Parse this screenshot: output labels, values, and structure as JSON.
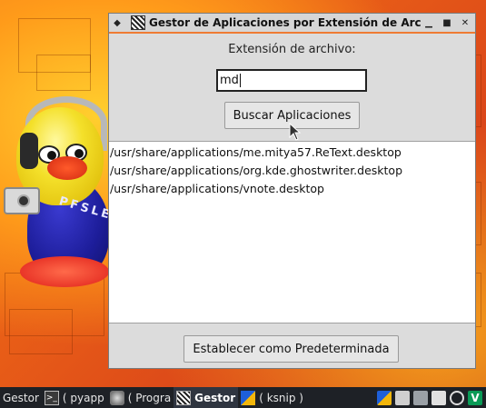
{
  "window": {
    "title": "Gestor de Aplicaciones por Extensión de Archiv",
    "extension_label": "Extensión de archivo:",
    "extension_value": "md",
    "search_button": "Buscar Aplicaciones",
    "results": [
      "/usr/share/applications/me.mitya57.ReText.desktop",
      "/usr/share/applications/org.kde.ghostwriter.desktop",
      "/usr/share/applications/vnote.desktop"
    ],
    "default_button": "Establecer como Predeterminada",
    "controls": {
      "minimize": "▁",
      "maximize": "■",
      "close": "✕",
      "menu": "◆"
    }
  },
  "wallpaper": {
    "letters": "PFSLE"
  },
  "taskbar": {
    "tasks": [
      {
        "label": "Gestor",
        "icon": "none"
      },
      {
        "label": "( pyapp",
        "icon": "terminal-icon"
      },
      {
        "label": "( Progra",
        "icon": "gnu-icon"
      },
      {
        "label": "Gestor",
        "icon": "app-icon",
        "active": true
      },
      {
        "label": "( ksnip )",
        "icon": "ksnip-icon"
      }
    ],
    "tray": [
      "ksnip-icon",
      "volume-icon",
      "network-icon",
      "document-icon",
      "clock-icon",
      "vim-icon"
    ]
  },
  "colors": {
    "title_accent": "#ef7b33",
    "taskbar": "#1e2126",
    "window_bg": "#dcdcdc"
  }
}
